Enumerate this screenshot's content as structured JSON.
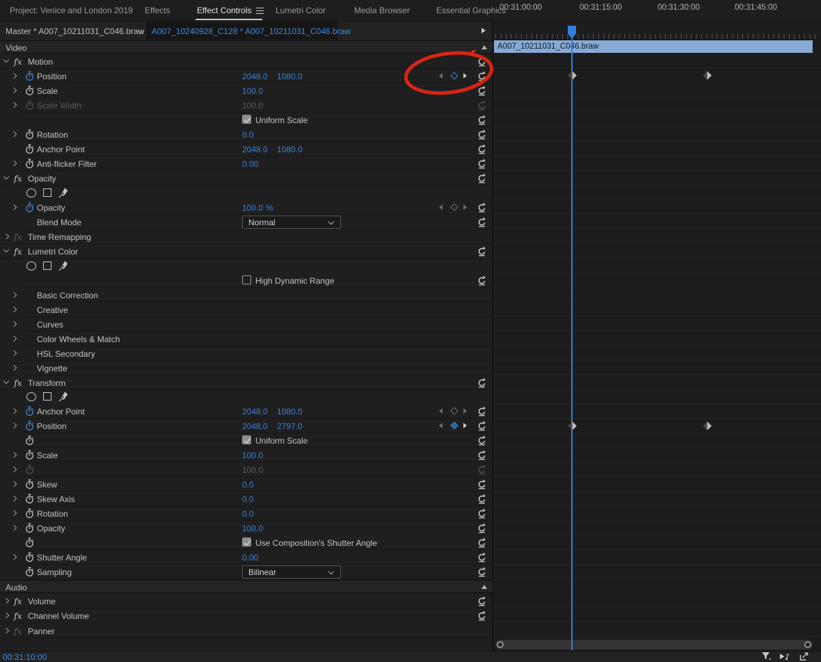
{
  "tabs": {
    "project": "Project: Venice and London 2019",
    "effects": "Effects",
    "effect_controls": "Effect Controls",
    "lumetri_color": "Lumetri Color",
    "media_browser": "Media Browser",
    "essential_graphics": "Essential Graphics"
  },
  "breadcrumb": {
    "master": "Master * A007_10211031_C046.braw",
    "sequence_clip": "A007_10240928_C128 * A007_10211031_C046.braw"
  },
  "ruler": {
    "t0": "00:31:00:00",
    "t1": "00:31:15:00",
    "t2": "00:31:30:00",
    "t3": "00:31:45:00"
  },
  "timeline": {
    "clip_name": "A007_10211031_C046.braw"
  },
  "video": {
    "header": "Video",
    "motion": {
      "name": "Motion",
      "position_label": "Position",
      "position_x": "2048.0",
      "position_y": "1080.0",
      "scale_label": "Scale",
      "scale_value": "100.0",
      "scale_width_label": "Scale Width",
      "scale_width_value": "100.0",
      "uniform_scale_label": "Uniform Scale",
      "rotation_label": "Rotation",
      "rotation_value": "0.0",
      "anchor_label": "Anchor Point",
      "anchor_x": "2048.0",
      "anchor_y": "1080.0",
      "antiflicker_label": "Anti-flicker Filter",
      "antiflicker_value": "0.00"
    },
    "opacity": {
      "name": "Opacity",
      "opacity_label": "Opacity",
      "opacity_value": "100.0",
      "opacity_unit": "%",
      "blend_mode_label": "Blend Mode",
      "blend_mode_value": "Normal"
    },
    "time_remapping": {
      "name": "Time Remapping"
    },
    "lumetri": {
      "name": "Lumetri Color",
      "hdr_label": "High Dynamic Range",
      "sections": [
        "Basic Correction",
        "Creative",
        "Curves",
        "Color Wheels & Match",
        "HSL Secondary",
        "Vignette"
      ]
    },
    "transform": {
      "name": "Transform",
      "anchor_label": "Anchor Point",
      "anchor_x": "2048.0",
      "anchor_y": "1080.0",
      "position_label": "Position",
      "position_x": "2048.0",
      "position_y": "2797.0",
      "uniform_scale_label": "Uniform Scale",
      "scale_label": "Scale",
      "scale_value": "100.0",
      "scale_height_value": "100.0",
      "skew_label": "Skew",
      "skew_value": "0.0",
      "skew_axis_label": "Skew Axis",
      "skew_axis_value": "0.0",
      "rotation_label": "Rotation",
      "rotation_value": "0.0",
      "opacity_label": "Opacity",
      "opacity_value": "100.0",
      "shutter_checkbox_label": "Use Composition's Shutter Angle",
      "shutter_angle_label": "Shutter Angle",
      "shutter_angle_value": "0.00",
      "sampling_label": "Sampling",
      "sampling_value": "Bilinear"
    }
  },
  "audio": {
    "header": "Audio",
    "volume_label": "Volume",
    "channel_volume_label": "Channel Volume",
    "panner_label": "Panner"
  },
  "footer": {
    "timecode": "00:31:10:00"
  },
  "colors": {
    "value_blue": "#3f7fd2",
    "playhead_blue": "#2f80e0",
    "clip_bar_blue": "#87aad5",
    "annotation_red": "#d92513",
    "timecode_blue": "#3f8ae0"
  }
}
